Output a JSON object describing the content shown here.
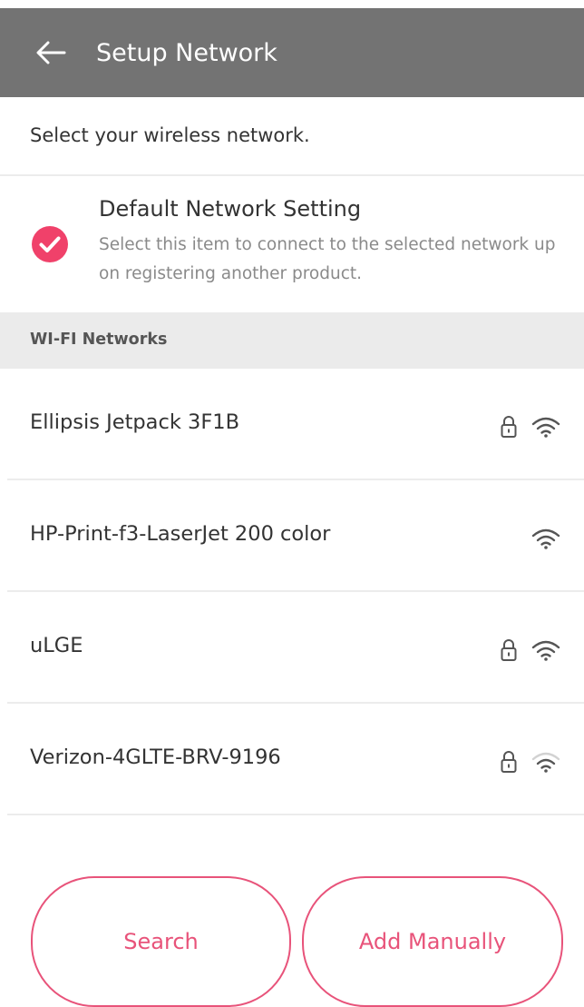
{
  "header": {
    "title": "Setup Network",
    "back_icon": "arrow-left-icon"
  },
  "intro": {
    "text": "Select your wireless network."
  },
  "default_setting": {
    "checked": true,
    "title": "Default Network Setting",
    "description": "Select this item to connect to the selected network upon registering another product.",
    "check_icon": "check-circle-icon",
    "accent_color": "#f0416a"
  },
  "wifi_section": {
    "title": "WI-FI Networks"
  },
  "networks": [
    {
      "name": "Ellipsis Jetpack 3F1B",
      "locked": true,
      "signal": 3,
      "icons": [
        "lock-icon",
        "wifi-icon"
      ]
    },
    {
      "name": "HP-Print-f3-LaserJet 200 color",
      "locked": false,
      "signal": 3,
      "icons": [
        "wifi-icon"
      ]
    },
    {
      "name": "uLGE",
      "locked": true,
      "signal": 3,
      "icons": [
        "lock-icon",
        "wifi-icon"
      ]
    },
    {
      "name": "Verizon-4GLTE-BRV-9196",
      "locked": true,
      "signal": 2,
      "icons": [
        "lock-icon",
        "wifi-icon"
      ]
    }
  ],
  "buttons": {
    "search_label": "Search",
    "add_manually_label": "Add Manually",
    "color": "#e8537a"
  },
  "colors": {
    "appbar": "#737373",
    "section_header": "#ebebeb"
  }
}
